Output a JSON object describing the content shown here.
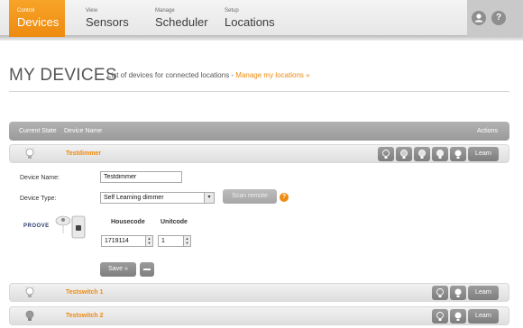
{
  "nav": {
    "tabs": [
      {
        "small": "Control",
        "big": "Devices"
      },
      {
        "small": "View",
        "big": "Sensors"
      },
      {
        "small": "Manage",
        "big": "Scheduler"
      },
      {
        "small": "Setup",
        "big": "Locations"
      }
    ],
    "user_icon": "user-icon",
    "help_icon": "help-icon",
    "help_glyph": "?"
  },
  "page": {
    "title": "MY DEVICES",
    "description": "List of devices for connected locations - ",
    "manage_link": "Manage my locations »"
  },
  "table": {
    "col_state": "Current State",
    "col_name": "Device Name",
    "col_actions": "Actions"
  },
  "devices": [
    {
      "name": "Testdimmer",
      "learn": "Learn"
    },
    {
      "name": "Testswitch 1",
      "learn": "Learn"
    },
    {
      "name": "Testswitch 2",
      "learn": "Learn"
    }
  ],
  "form": {
    "device_name_label": "Device Name:",
    "device_name_value": "Testdimmer",
    "device_type_label": "Device Type:",
    "device_type_value": "Self Learning dimmer",
    "scan_remote": "Scan remote",
    "help_glyph": "?",
    "brand_logo": "PROOVE",
    "housecode_label": "Housecode",
    "unitcode_label": "Unitcode",
    "housecode_value": "1719114",
    "unitcode_value": "1",
    "save_label": "Save »"
  },
  "colors": {
    "accent": "#ee8a10",
    "button_gray": "#8e8e8e"
  }
}
